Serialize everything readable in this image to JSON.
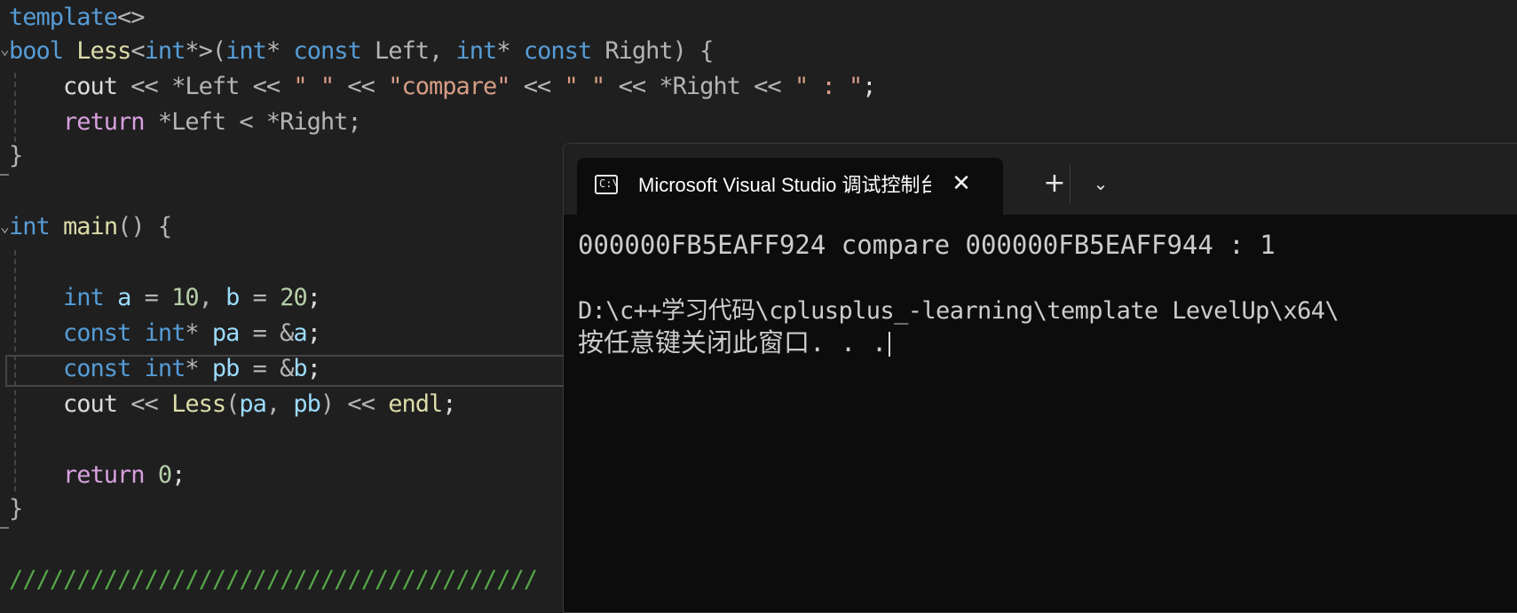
{
  "editor": {
    "lines": [
      [
        {
          "t": "template",
          "c": "kw"
        },
        {
          "t": "<>",
          "c": "op"
        }
      ],
      [
        {
          "t": "bool",
          "c": "kw"
        },
        {
          "t": " ",
          "c": "plain"
        },
        {
          "t": "Less",
          "c": "fn"
        },
        {
          "t": "<",
          "c": "op"
        },
        {
          "t": "int",
          "c": "kw"
        },
        {
          "t": "*>(",
          "c": "op"
        },
        {
          "t": "int",
          "c": "kw"
        },
        {
          "t": "* ",
          "c": "op"
        },
        {
          "t": "const",
          "c": "kw"
        },
        {
          "t": " Left, ",
          "c": "op"
        },
        {
          "t": "int",
          "c": "kw"
        },
        {
          "t": "* ",
          "c": "op"
        },
        {
          "t": "const",
          "c": "kw"
        },
        {
          "t": " Right) {",
          "c": "op"
        }
      ],
      [
        {
          "t": "    cout",
          "c": "plain"
        },
        {
          "t": " << ",
          "c": "op"
        },
        {
          "t": "*Left",
          "c": "op"
        },
        {
          "t": " << ",
          "c": "op"
        },
        {
          "t": "\" \"",
          "c": "str"
        },
        {
          "t": " << ",
          "c": "op"
        },
        {
          "t": "\"compare\"",
          "c": "str"
        },
        {
          "t": " << ",
          "c": "op"
        },
        {
          "t": "\" \"",
          "c": "str"
        },
        {
          "t": " << ",
          "c": "op"
        },
        {
          "t": "*Right",
          "c": "op"
        },
        {
          "t": " << ",
          "c": "op"
        },
        {
          "t": "\" : \"",
          "c": "str"
        },
        {
          "t": ";",
          "c": "plain"
        }
      ],
      [
        {
          "t": "    ",
          "c": "plain"
        },
        {
          "t": "return",
          "c": "ret"
        },
        {
          "t": " *Left < *Right;",
          "c": "op"
        }
      ],
      [
        {
          "t": "}",
          "c": "op"
        }
      ],
      [],
      [
        {
          "t": "int",
          "c": "kw"
        },
        {
          "t": " ",
          "c": "plain"
        },
        {
          "t": "main",
          "c": "fn"
        },
        {
          "t": "() {",
          "c": "op"
        }
      ],
      [],
      [
        {
          "t": "    ",
          "c": "plain"
        },
        {
          "t": "int",
          "c": "kw"
        },
        {
          "t": " ",
          "c": "plain"
        },
        {
          "t": "a",
          "c": "var"
        },
        {
          "t": " = ",
          "c": "op"
        },
        {
          "t": "10",
          "c": "num"
        },
        {
          "t": ", ",
          "c": "op"
        },
        {
          "t": "b",
          "c": "var"
        },
        {
          "t": " = ",
          "c": "op"
        },
        {
          "t": "20",
          "c": "num"
        },
        {
          "t": ";",
          "c": "plain"
        }
      ],
      [
        {
          "t": "    ",
          "c": "plain"
        },
        {
          "t": "const",
          "c": "kw"
        },
        {
          "t": " ",
          "c": "plain"
        },
        {
          "t": "int",
          "c": "kw"
        },
        {
          "t": "* ",
          "c": "op"
        },
        {
          "t": "pa",
          "c": "var"
        },
        {
          "t": " = &",
          "c": "op"
        },
        {
          "t": "a",
          "c": "var"
        },
        {
          "t": ";",
          "c": "plain"
        }
      ],
      [
        {
          "t": "    ",
          "c": "plain"
        },
        {
          "t": "const",
          "c": "kw"
        },
        {
          "t": " ",
          "c": "plain"
        },
        {
          "t": "int",
          "c": "kw"
        },
        {
          "t": "* ",
          "c": "op"
        },
        {
          "t": "pb",
          "c": "var"
        },
        {
          "t": " = &",
          "c": "op"
        },
        {
          "t": "b",
          "c": "var"
        },
        {
          "t": ";",
          "c": "plain"
        }
      ],
      [
        {
          "t": "    cout",
          "c": "plain"
        },
        {
          "t": " << ",
          "c": "op"
        },
        {
          "t": "Less",
          "c": "fn"
        },
        {
          "t": "(",
          "c": "op"
        },
        {
          "t": "pa",
          "c": "var"
        },
        {
          "t": ", ",
          "c": "op"
        },
        {
          "t": "pb",
          "c": "var"
        },
        {
          "t": ") << ",
          "c": "op"
        },
        {
          "t": "endl",
          "c": "fn"
        },
        {
          "t": ";",
          "c": "plain"
        }
      ],
      [],
      [
        {
          "t": "    ",
          "c": "plain"
        },
        {
          "t": "return",
          "c": "ret"
        },
        {
          "t": " ",
          "c": "plain"
        },
        {
          "t": "0",
          "c": "num"
        },
        {
          "t": ";",
          "c": "plain"
        }
      ],
      [
        {
          "t": "}",
          "c": "op"
        }
      ],
      [],
      [
        {
          "t": "///////////////////////////////////////",
          "c": "cmt"
        }
      ]
    ]
  },
  "terminal": {
    "tab_icon_text": "C:\\",
    "tab_title": "Microsoft Visual Studio 调试控制台",
    "tab_close": "✕",
    "new_tab": "+",
    "dropdown": "⌄",
    "output_lines": [
      "000000FB5EAFF924 compare 000000FB5EAFF944 : 1",
      "",
      "D:\\c++学习代码\\cplusplus_-learning\\template LevelUp\\x64\\",
      "按任意键关闭此窗口. . ."
    ]
  }
}
